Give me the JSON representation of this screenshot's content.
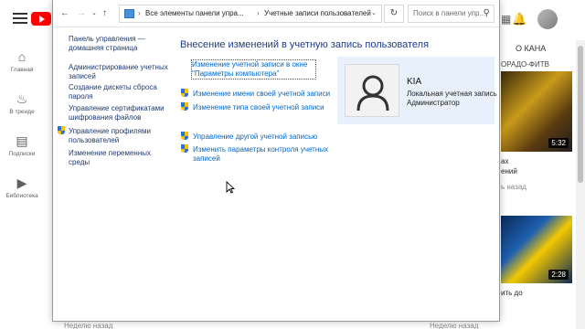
{
  "youtube": {
    "sidebar": [
      {
        "label": "Главная",
        "icon": "home-icon"
      },
      {
        "label": "В тренде",
        "icon": "fire-icon"
      },
      {
        "label": "Подписки",
        "icon": "subscriptions-icon"
      },
      {
        "label": "Библиотека",
        "icon": "library-icon"
      }
    ],
    "channel_label": "О КАНА",
    "sub_text": "ОРАДО-ФИТВ",
    "video1": {
      "duration": "5:32",
      "title_line1": "ах",
      "title_line2": "ений",
      "meta": "ь назад"
    },
    "video2": {
      "duration": "2:28",
      "title_line1": "",
      "title_line2": "ить до"
    },
    "bottom_left": "Неделю назад",
    "bottom_right": "Неделю назад",
    "help_label": "?"
  },
  "window": {
    "address": {
      "crumb1": "Все элементы панели упра...",
      "crumb2": "Учетные записи пользователей",
      "search_placeholder": "Поиск в панели упр..."
    },
    "left_nav": [
      {
        "label": "Панель управления — домашняя страница",
        "shield": false
      },
      {
        "label": "Администрирование учетных записей",
        "shield": false
      },
      {
        "label": "Создание дискеты сброса пароля",
        "shield": false
      },
      {
        "label": "Управление сертификатами шифрования файлов",
        "shield": false
      },
      {
        "label": "Управление профилями пользователей",
        "shield": true
      },
      {
        "label": "Изменение переменных среды",
        "shield": false
      }
    ],
    "heading": "Внесение изменений в учетную запись пользователя",
    "links": {
      "pc_settings": "Изменение учетной записи в окне \"Параметры компьютера\"",
      "change_name": "Изменение имени своей учетной записи",
      "change_type": "Изменение типа своей учетной записи",
      "manage_other": "Управление другой учетной записью",
      "uac_settings": "Изменить параметры контроля учетных записей"
    },
    "user": {
      "name": "KIA",
      "type": "Локальная учетная запись",
      "role": "Администратор"
    }
  }
}
